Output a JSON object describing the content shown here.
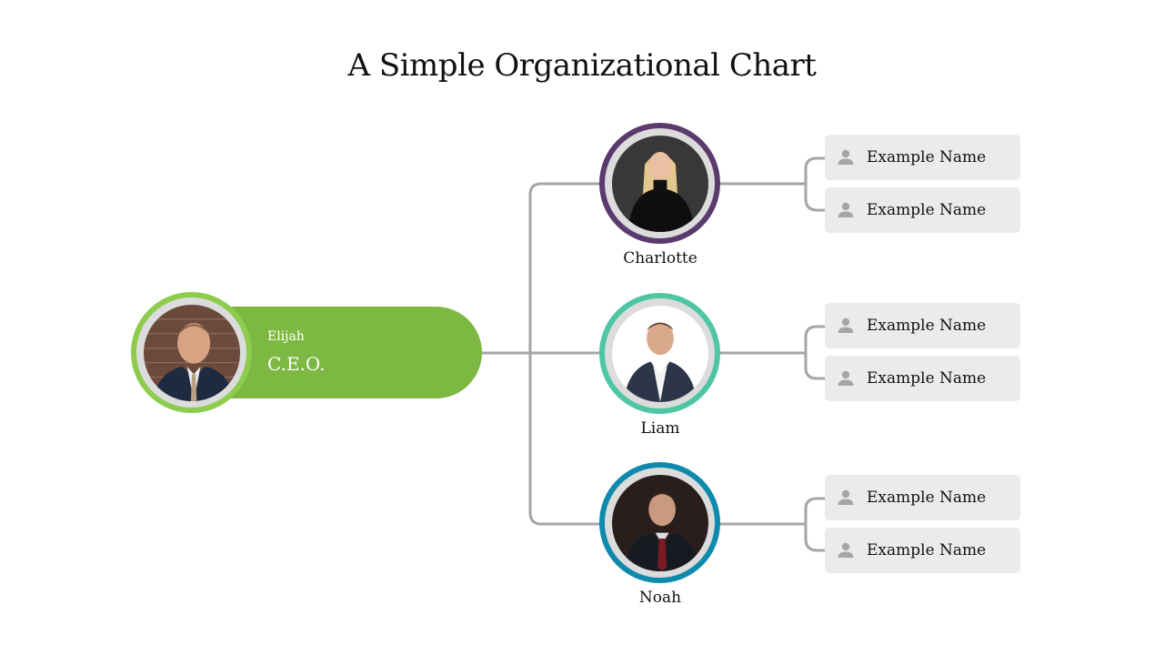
{
  "title": "A Simple Organizational Chart",
  "ceo": {
    "name": "Elijah",
    "role": "C.E.O.",
    "photo_icon": "person-photo",
    "ring_color": "#8dcc4c",
    "pill_color": "#7db843"
  },
  "managers": [
    {
      "name": "Charlotte",
      "ring_color": "#5b3a6e",
      "photo_icon": "person-photo",
      "reports": [
        {
          "label": "Example Name",
          "icon": "user-icon"
        },
        {
          "label": "Example Name",
          "icon": "user-icon"
        }
      ]
    },
    {
      "name": "Liam",
      "ring_color": "#4fc6a3",
      "photo_icon": "person-photo",
      "reports": [
        {
          "label": "Example Name",
          "icon": "user-icon"
        },
        {
          "label": "Example Name",
          "icon": "user-icon"
        }
      ]
    },
    {
      "name": "Noah",
      "ring_color": "#0f8aac",
      "photo_icon": "person-photo",
      "reports": [
        {
          "label": "Example Name",
          "icon": "user-icon"
        },
        {
          "label": "Example Name",
          "icon": "user-icon"
        }
      ]
    }
  ],
  "colors": {
    "connector": "#a6a6a6",
    "sub_box_bg": "#ebebeb",
    "sub_icon": "#a6a6a6",
    "avatar_inner": "#dcdcdc"
  }
}
